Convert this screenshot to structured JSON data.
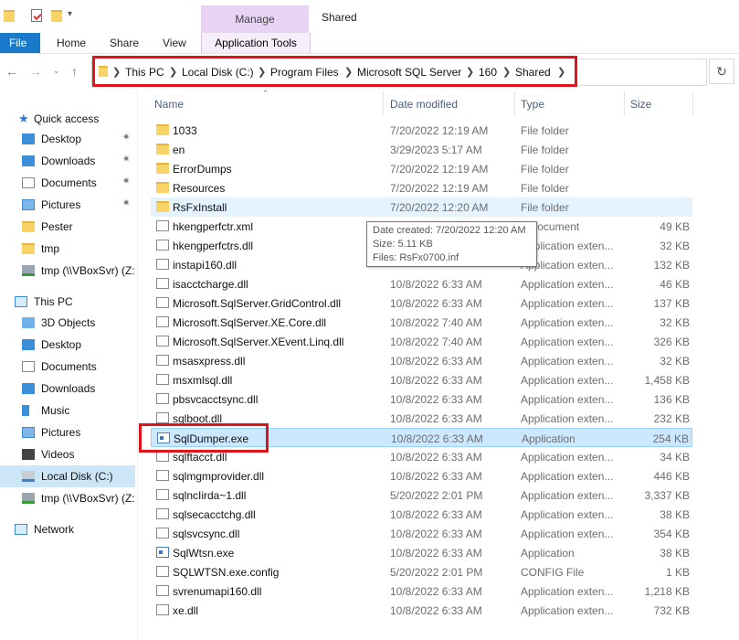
{
  "window": {
    "title": "Shared",
    "manage_tab": "Manage",
    "ribbon_tabs": [
      "File",
      "Home",
      "Share",
      "View",
      "Application Tools"
    ]
  },
  "address": {
    "crumbs": [
      "This PC",
      "Local Disk (C:)",
      "Program Files",
      "Microsoft SQL Server",
      "160",
      "Shared"
    ]
  },
  "nav": {
    "quick_access": "Quick access",
    "quick_items": [
      {
        "label": "Desktop",
        "icon": "desktop-icon",
        "pinned": true
      },
      {
        "label": "Downloads",
        "icon": "download-icon",
        "pinned": true
      },
      {
        "label": "Documents",
        "icon": "documents-icon",
        "pinned": true
      },
      {
        "label": "Pictures",
        "icon": "pictures-icon",
        "pinned": true
      },
      {
        "label": "Pester",
        "icon": "folder-icon",
        "pinned": false
      },
      {
        "label": "tmp",
        "icon": "folder-icon",
        "pinned": false
      },
      {
        "label": "tmp (\\\\VBoxSvr) (Z:",
        "icon": "network-drive-icon",
        "pinned": false
      }
    ],
    "this_pc": "This PC",
    "pc_items": [
      {
        "label": "3D Objects",
        "icon": "3d-objects-icon"
      },
      {
        "label": "Desktop",
        "icon": "desktop-icon"
      },
      {
        "label": "Documents",
        "icon": "documents-icon"
      },
      {
        "label": "Downloads",
        "icon": "download-icon"
      },
      {
        "label": "Music",
        "icon": "music-icon"
      },
      {
        "label": "Pictures",
        "icon": "pictures-icon"
      },
      {
        "label": "Videos",
        "icon": "videos-icon"
      },
      {
        "label": "Local Disk (C:)",
        "icon": "drive-icon",
        "selected": true
      },
      {
        "label": "tmp (\\\\VBoxSvr) (Z:",
        "icon": "network-drive-icon"
      }
    ],
    "network": "Network"
  },
  "columns": {
    "name": "Name",
    "date": "Date modified",
    "type": "Type",
    "size": "Size"
  },
  "files": [
    {
      "name": "1033",
      "date": "7/20/2022 12:19 AM",
      "type": "File folder",
      "size": "",
      "kind": "folder"
    },
    {
      "name": "en",
      "date": "3/29/2023 5:17 AM",
      "type": "File folder",
      "size": "",
      "kind": "folder"
    },
    {
      "name": "ErrorDumps",
      "date": "7/20/2022 12:19 AM",
      "type": "File folder",
      "size": "",
      "kind": "folder"
    },
    {
      "name": "Resources",
      "date": "7/20/2022 12:19 AM",
      "type": "File folder",
      "size": "",
      "kind": "folder"
    },
    {
      "name": "RsFxInstall",
      "date": "7/20/2022 12:20 AM",
      "type": "File folder",
      "size": "",
      "kind": "folder",
      "state": "hover"
    },
    {
      "name": "hkengperfctr.xml",
      "date": "",
      "type": "L Document",
      "size": "49 KB",
      "kind": "doc"
    },
    {
      "name": "hkengperfctrs.dll",
      "date": "",
      "type": "Application exten...",
      "size": "32 KB",
      "kind": "doc"
    },
    {
      "name": "instapi160.dll",
      "date": "",
      "type": "Application exten...",
      "size": "132 KB",
      "kind": "doc"
    },
    {
      "name": "isacctcharge.dll",
      "date": "10/8/2022 6:33 AM",
      "type": "Application exten...",
      "size": "46 KB",
      "kind": "doc"
    },
    {
      "name": "Microsoft.SqlServer.GridControl.dll",
      "date": "10/8/2022 6:33 AM",
      "type": "Application exten...",
      "size": "137 KB",
      "kind": "doc"
    },
    {
      "name": "Microsoft.SqlServer.XE.Core.dll",
      "date": "10/8/2022 7:40 AM",
      "type": "Application exten...",
      "size": "32 KB",
      "kind": "doc"
    },
    {
      "name": "Microsoft.SqlServer.XEvent.Linq.dll",
      "date": "10/8/2022 7:40 AM",
      "type": "Application exten...",
      "size": "326 KB",
      "kind": "doc"
    },
    {
      "name": "msasxpress.dll",
      "date": "10/8/2022 6:33 AM",
      "type": "Application exten...",
      "size": "32 KB",
      "kind": "doc"
    },
    {
      "name": "msxmlsql.dll",
      "date": "10/8/2022 6:33 AM",
      "type": "Application exten...",
      "size": "1,458 KB",
      "kind": "doc"
    },
    {
      "name": "pbsvcacctsync.dll",
      "date": "10/8/2022 6:33 AM",
      "type": "Application exten...",
      "size": "136 KB",
      "kind": "doc"
    },
    {
      "name": "sqlboot.dll",
      "date": "10/8/2022 6:33 AM",
      "type": "Application exten...",
      "size": "232 KB",
      "kind": "doc"
    },
    {
      "name": "SqlDumper.exe",
      "date": "10/8/2022 6:33 AM",
      "type": "Application",
      "size": "254 KB",
      "kind": "exe",
      "state": "selected"
    },
    {
      "name": "sqlftacct.dll",
      "date": "10/8/2022 6:33 AM",
      "type": "Application exten...",
      "size": "34 KB",
      "kind": "doc"
    },
    {
      "name": "sqlmgmprovider.dll",
      "date": "10/8/2022 6:33 AM",
      "type": "Application exten...",
      "size": "446 KB",
      "kind": "doc"
    },
    {
      "name": "sqlncIirda~1.dll",
      "date": "5/20/2022 2:01 PM",
      "type": "Application exten...",
      "size": "3,337 KB",
      "kind": "doc"
    },
    {
      "name": "sqlsecacctchg.dll",
      "date": "10/8/2022 6:33 AM",
      "type": "Application exten...",
      "size": "38 KB",
      "kind": "doc"
    },
    {
      "name": "sqlsvcsync.dll",
      "date": "10/8/2022 6:33 AM",
      "type": "Application exten...",
      "size": "354 KB",
      "kind": "doc"
    },
    {
      "name": "SqlWtsn.exe",
      "date": "10/8/2022 6:33 AM",
      "type": "Application",
      "size": "38 KB",
      "kind": "exe"
    },
    {
      "name": "SQLWTSN.exe.config",
      "date": "5/20/2022 2:01 PM",
      "type": "CONFIG File",
      "size": "1 KB",
      "kind": "doc"
    },
    {
      "name": "svrenumapi160.dll",
      "date": "10/8/2022 6:33 AM",
      "type": "Application exten...",
      "size": "1,218 KB",
      "kind": "doc"
    },
    {
      "name": "xe.dll",
      "date": "10/8/2022 6:33 AM",
      "type": "Application exten...",
      "size": "732 KB",
      "kind": "doc"
    }
  ],
  "tooltip": {
    "created": "Date created: 7/20/2022 12:20 AM",
    "size": "Size: 5.11 KB",
    "files": "Files: RsFx0700.inf"
  },
  "colors": {
    "highlight_box": "#e0151c",
    "manage_tab": "#e9d3f5",
    "file_tab": "#1979ca",
    "selection": "#cce8ff"
  }
}
